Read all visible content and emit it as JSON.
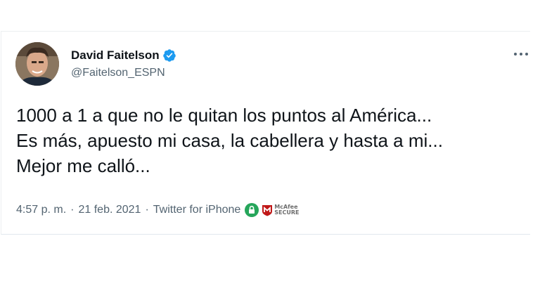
{
  "tweet": {
    "author": {
      "display_name": "David Faitelson",
      "handle": "@Faitelson_ESPN",
      "verified": true,
      "avatar_icon": "profile-photo"
    },
    "text_lines": [
      "1000 a 1 a que no le quitan los puntos al América...",
      "Es más, apuesto mi casa, la cabellera y hasta a mi...",
      "Mejor me calló..."
    ],
    "time": "4:57 p. m.",
    "separator": "·",
    "date": "21 feb. 2021",
    "source": "Twitter for iPhone",
    "more_icon": "more-dots-icon"
  },
  "badges": {
    "lock_icon": "green-lock-icon",
    "mcafee_line1": "McAfee",
    "mcafee_line2": "SECURE"
  },
  "colors": {
    "text_primary": "#0f1419",
    "text_secondary": "#536471",
    "verified_blue": "#1d9bf0",
    "lock_green": "#26a65b",
    "mcafee_red": "#c01818"
  }
}
